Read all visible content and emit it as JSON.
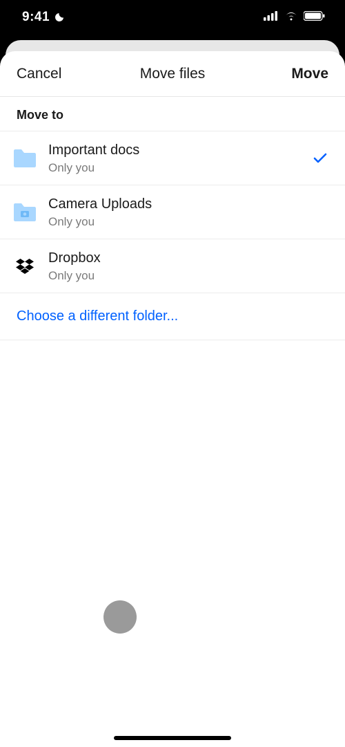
{
  "status": {
    "time": "9:41"
  },
  "nav": {
    "cancel": "Cancel",
    "title": "Move files",
    "action": "Move"
  },
  "section": {
    "header": "Move to"
  },
  "folders": [
    {
      "name": "Important docs",
      "sub": "Only you",
      "icon": "folder",
      "selected": true
    },
    {
      "name": "Camera Uploads",
      "sub": "Only you",
      "icon": "folder-camera",
      "selected": false
    },
    {
      "name": "Dropbox",
      "sub": "Only you",
      "icon": "dropbox",
      "selected": false
    }
  ],
  "choose": {
    "label": "Choose a different folder..."
  },
  "colors": {
    "accent": "#0061ff",
    "folder": "#a9d7ff",
    "folder_camera": "#6fb9f7",
    "dropbox": "#000000"
  }
}
